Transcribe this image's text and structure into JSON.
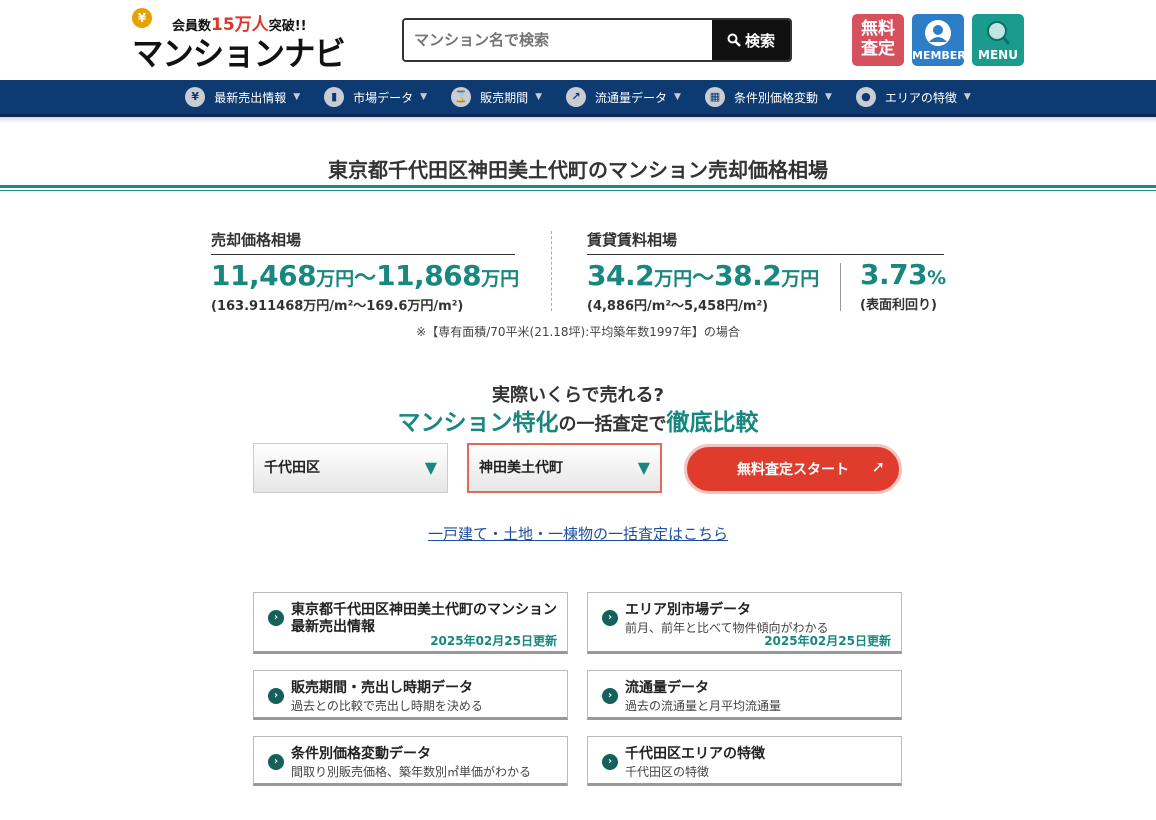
{
  "header": {
    "logo": {
      "yen": "¥",
      "tagline_prefix": "会員数",
      "tagline_number": "15万人",
      "tagline_suffix": "突破!!",
      "wordmark": "マンションナビ"
    },
    "search": {
      "placeholder": "マンション名で検索",
      "button_label": "検索"
    },
    "buttons": {
      "assess_line1": "無料",
      "assess_line2": "査定",
      "member": "MEMBER",
      "menu": "MENU"
    }
  },
  "nav": {
    "items": [
      {
        "label": "最新売出情報",
        "icon": "¥"
      },
      {
        "label": "市場データ",
        "icon": "▮"
      },
      {
        "label": "販売期間",
        "icon": "⌛"
      },
      {
        "label": "流通量データ",
        "icon": "↗"
      },
      {
        "label": "条件別価格変動",
        "icon": "▦"
      },
      {
        "label": "エリアの特徴",
        "icon": "●"
      }
    ],
    "caret": "▼"
  },
  "page": {
    "title": "東京都千代田区神田美土代町のマンション売却価格相場"
  },
  "sale": {
    "label": "売却価格相場",
    "low": "11,468",
    "high": "11,868",
    "unit": "万円",
    "tilde": "〜",
    "per_sqm": "(163.911468万円/m²〜169.6万円/m²)"
  },
  "rent": {
    "label": "賃貸賃料相場",
    "low": "34.2",
    "high": "38.2",
    "unit": "万円",
    "tilde": "〜",
    "per_sqm": "(4,886円/m²〜5,458円/m²)",
    "yield_value": "3.73",
    "yield_unit": "%",
    "yield_label": "(表面利回り)"
  },
  "footnote": "※【専有面積/70平米(21.18坪):平均築年数1997年】の場合",
  "cta": {
    "question": "実際いくらで売れる?",
    "line_em1": "マンション特化",
    "line_mid": "の一括査定で",
    "line_em2": "徹底比較",
    "ward_select": "千代田区",
    "town_select": "神田美土代町",
    "start_button": "無料査定スタート",
    "alt_link": "一戸建て・土地・一棟物の一括査定はこちら"
  },
  "cards": [
    {
      "title1": "東京都千代田区神田美土代町のマンション",
      "title2": "最新売出情報",
      "updated": "2025年02月25日更新"
    },
    {
      "title1": "エリア別市場データ",
      "desc": "前月、前年と比べて物件傾向がわかる",
      "updated": "2025年02月25日更新"
    },
    {
      "title1": "販売期間・売出し時期データ",
      "desc": "過去との比較で売出し時期を決める"
    },
    {
      "title1": "流通量データ",
      "desc": "過去の流通量と月平均流通量"
    },
    {
      "title1": "条件別価格変動データ",
      "desc": "間取り別販売価格、築年数別㎡単価がわかる"
    },
    {
      "title1": "千代田区エリアの特徴",
      "desc": "千代田区の特徴"
    }
  ],
  "colors": {
    "nav_bg": "#0e3a72",
    "accent_teal": "#17877f",
    "cta_red": "#e03c2e",
    "link_blue": "#1f4e9c"
  }
}
